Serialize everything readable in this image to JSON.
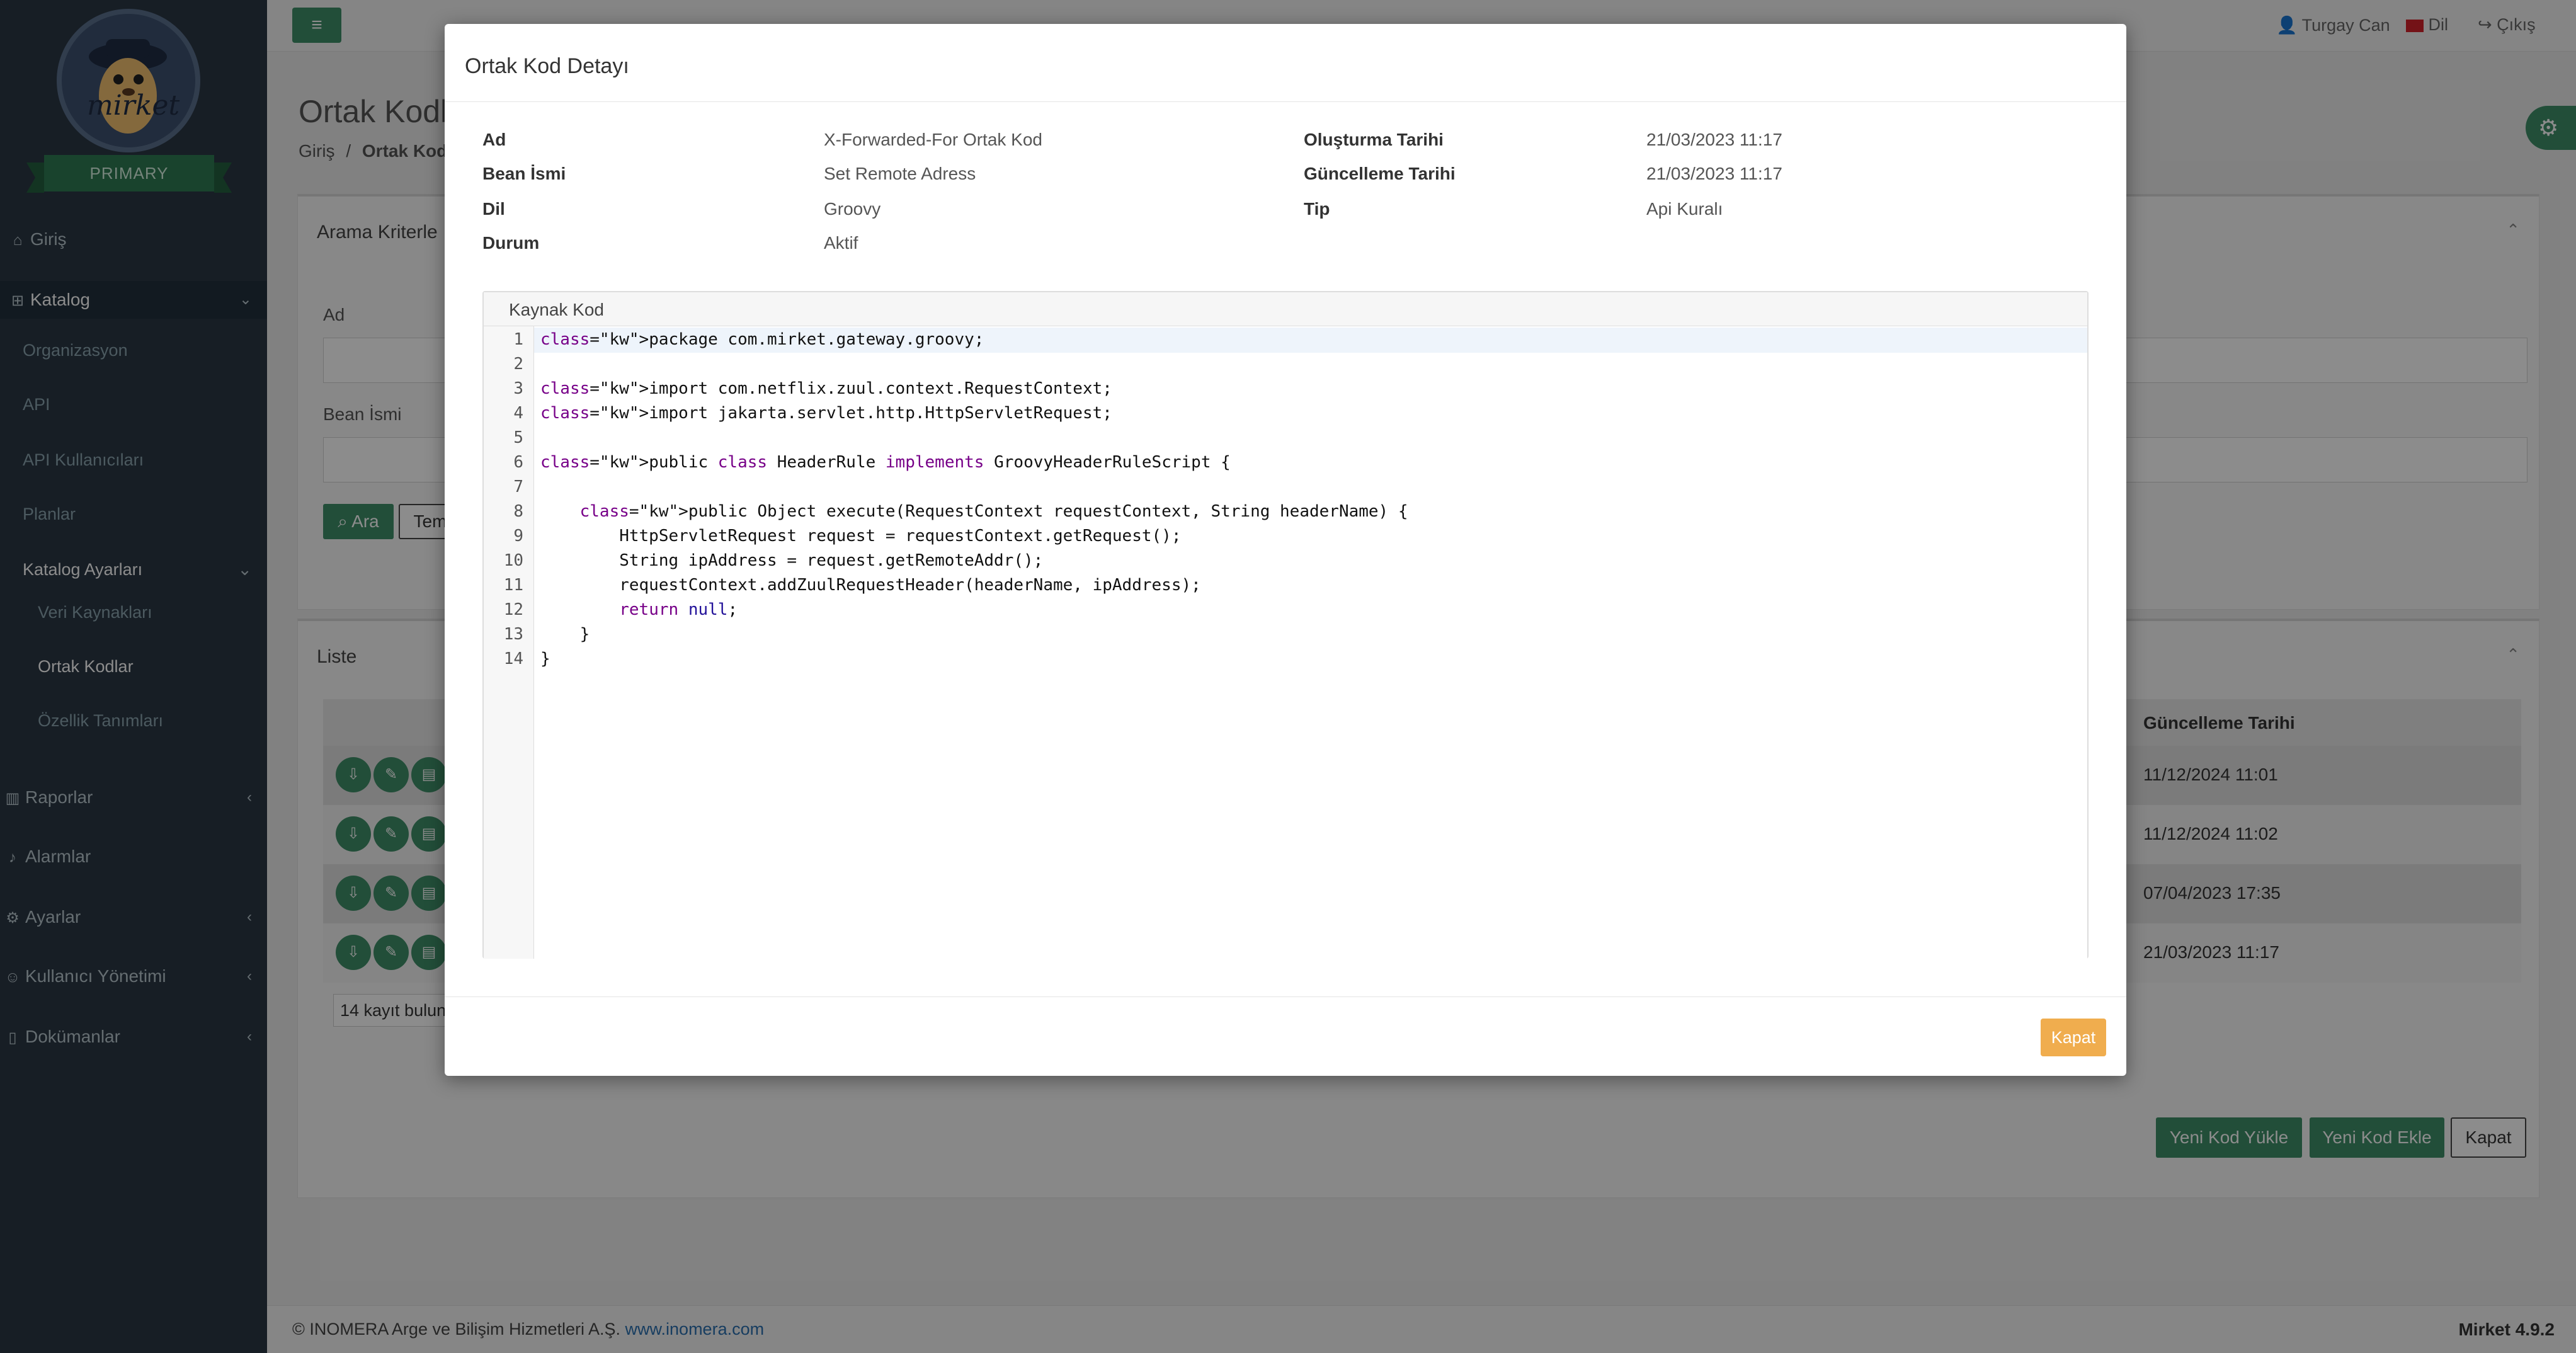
{
  "topbar": {
    "user": "Turgay Can",
    "language": "Dil",
    "logout": "Çıkış"
  },
  "logo": {
    "ribbon": "PRIMARY",
    "text": "mirket"
  },
  "sidebar": {
    "items": [
      {
        "label": "Giriş",
        "icon": "home-icon"
      },
      {
        "label": "Katalog",
        "icon": "sitemap-icon"
      },
      {
        "label": "Organizasyon"
      },
      {
        "label": "API"
      },
      {
        "label": "API Kullanıcıları"
      },
      {
        "label": "Planlar"
      },
      {
        "label": "Katalog Ayarları"
      },
      {
        "label": "Veri Kaynakları"
      },
      {
        "label": "Ortak Kodlar"
      },
      {
        "label": "Özellik Tanımları"
      },
      {
        "label": "Raporlar",
        "icon": "chart-icon"
      },
      {
        "label": "Alarmlar",
        "icon": "bell-icon"
      },
      {
        "label": "Ayarlar",
        "icon": "gears-icon"
      },
      {
        "label": "Kullanıcı Yönetimi",
        "icon": "users-icon"
      },
      {
        "label": "Dokümanlar",
        "icon": "file-icon"
      }
    ]
  },
  "main": {
    "title": "Ortak Kodla",
    "breadcrumb": {
      "home": "Giriş",
      "separator": "/",
      "current": "Ortak Kodla"
    },
    "search_panel": {
      "title": "Arama Kriterle",
      "label_name": "Ad",
      "label_bean": "Bean İsmi",
      "search_btn": "Ara",
      "clear_btn": "Tem"
    },
    "list_panel": {
      "title": "Liste",
      "date_header": "Güncelleme Tarihi",
      "dates": [
        "11/12/2024 11:01",
        "11/12/2024 11:02",
        "07/04/2023 17:35",
        "21/03/2023 11:17"
      ],
      "record_count": "14 kayıt bulun",
      "btn_upload": "Yeni Kod Yükle",
      "btn_add": "Yeni Kod Ekle",
      "btn_close": "Kapat"
    }
  },
  "footer": {
    "copyright": "© INOMERA Arge ve Bilişim Hizmetleri A.Ş.",
    "link": "www.inomera.com",
    "version": "Mirket 4.9.2"
  },
  "modal": {
    "title": "Ortak Kod Detayı",
    "fields": {
      "name_label": "Ad",
      "name_value": "X-Forwarded-For Ortak Kod",
      "bean_label": "Bean İsmi",
      "bean_value": "Set Remote Adress",
      "lang_label": "Dil",
      "lang_value": "Groovy",
      "status_label": "Durum",
      "status_value": "Aktif",
      "created_label": "Oluşturma Tarihi",
      "created_value": "21/03/2023 11:17",
      "updated_label": "Güncelleme Tarihi",
      "updated_value": "21/03/2023 11:17",
      "type_label": "Tip",
      "type_value": "Api Kuralı"
    },
    "source_title": "Kaynak Kod",
    "line_numbers": [
      "1",
      "2",
      "3",
      "4",
      "5",
      "6",
      "7",
      "8",
      "9",
      "10",
      "11",
      "12",
      "13",
      "14"
    ],
    "code_lines": [
      "package com.mirket.gateway.groovy;",
      "",
      "import com.netflix.zuul.context.RequestContext;",
      "import jakarta.servlet.http.HttpServletRequest;",
      "",
      "public class HeaderRule implements GroovyHeaderRuleScript {",
      "",
      "    public Object execute(RequestContext requestContext, String headerName) {",
      "        HttpServletRequest request = requestContext.getRequest();",
      "        String ipAddress = request.getRemoteAddr();",
      "        requestContext.addZuulRequestHeader(headerName, ipAddress);",
      "        return null;",
      "    }",
      "}"
    ],
    "close_btn": "Kapat"
  }
}
